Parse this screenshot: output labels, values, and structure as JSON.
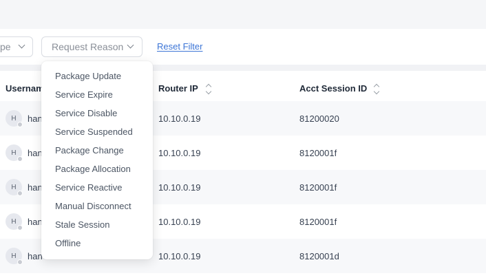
{
  "filters": {
    "type_label": "pe",
    "reason_placeholder": "Request Reason",
    "reset_label": "Reset Filter"
  },
  "dropdown": {
    "options": [
      "Package Update",
      "Service Expire",
      "Service Disable",
      "Service Suspended",
      "Package Change",
      "Package Allocation",
      "Service Reactive",
      "Manual Disconnect",
      "Stale Session",
      "Offline"
    ]
  },
  "table": {
    "headers": {
      "username": "Usernam",
      "router_ip": "Router IP",
      "session_id": "Acct Session ID"
    },
    "rows": [
      {
        "avatar": "H",
        "username": "han",
        "router_ip": "10.10.0.19",
        "session_id": "81200020"
      },
      {
        "avatar": "H",
        "username": "han",
        "router_ip": "10.10.0.19",
        "session_id": "8120001f"
      },
      {
        "avatar": "H",
        "username": "han",
        "router_ip": "10.10.0.19",
        "session_id": "8120001f"
      },
      {
        "avatar": "H",
        "username": "han",
        "router_ip": "10.10.0.19",
        "session_id": "8120001f"
      },
      {
        "avatar": "H",
        "username": "han",
        "router_ip": "10.10.0.19",
        "session_id": "8120001d"
      }
    ]
  }
}
